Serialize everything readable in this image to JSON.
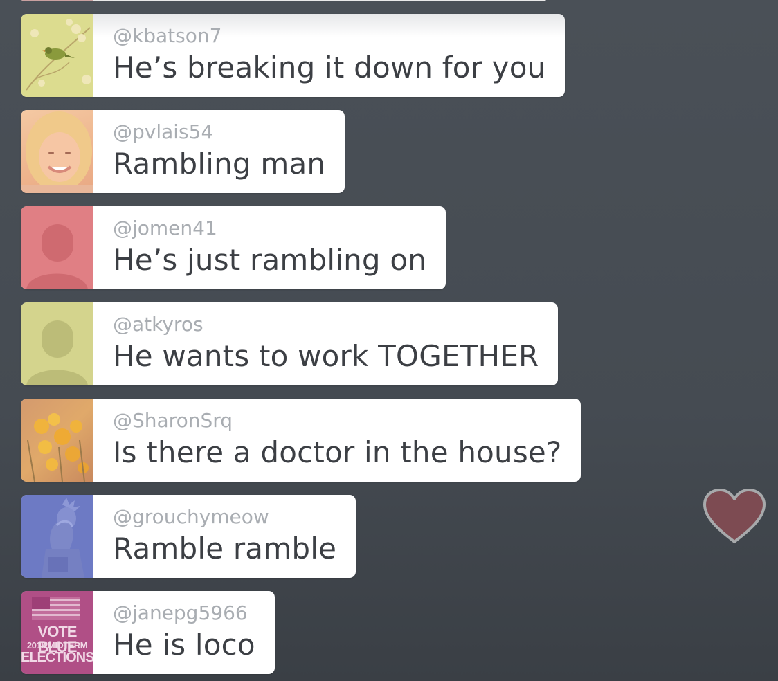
{
  "comments": [
    {
      "handle": "@kbatson7",
      "message": "He’s breaking it down for you",
      "avatar": "bird-on-branch"
    },
    {
      "handle": "@pvlais54",
      "message": "Rambling man",
      "avatar": "smiling-woman-photo"
    },
    {
      "handle": "@jomen41",
      "message": "He’s just rambling on",
      "avatar": "default-silhouette"
    },
    {
      "handle": "@atkyros",
      "message": "He wants to work TOGETHER",
      "avatar": "default-silhouette"
    },
    {
      "handle": "@SharonSrq",
      "message": "Is there a doctor in the house?",
      "avatar": "orange-flowers-photo"
    },
    {
      "handle": "@grouchymeow",
      "message": "Ramble ramble",
      "avatar": "statue-of-liberty-facepalm"
    },
    {
      "handle": "@janepg5966",
      "message": "He is loco",
      "avatar": "vote-blue-flag"
    }
  ],
  "jane_avatar_text": {
    "line1": "VOTE BLUE",
    "line2": "2018 MIDTERM",
    "line3": "ELECTIONS"
  },
  "colors": {
    "background": "#454b52",
    "bubble": "#ffffff",
    "handle": "#a9adb2",
    "message": "#3c3f44",
    "heart_fill": "#7d4b52",
    "heart_stroke": "#a7a9ab"
  },
  "icons": {
    "heart": "heart-icon"
  }
}
